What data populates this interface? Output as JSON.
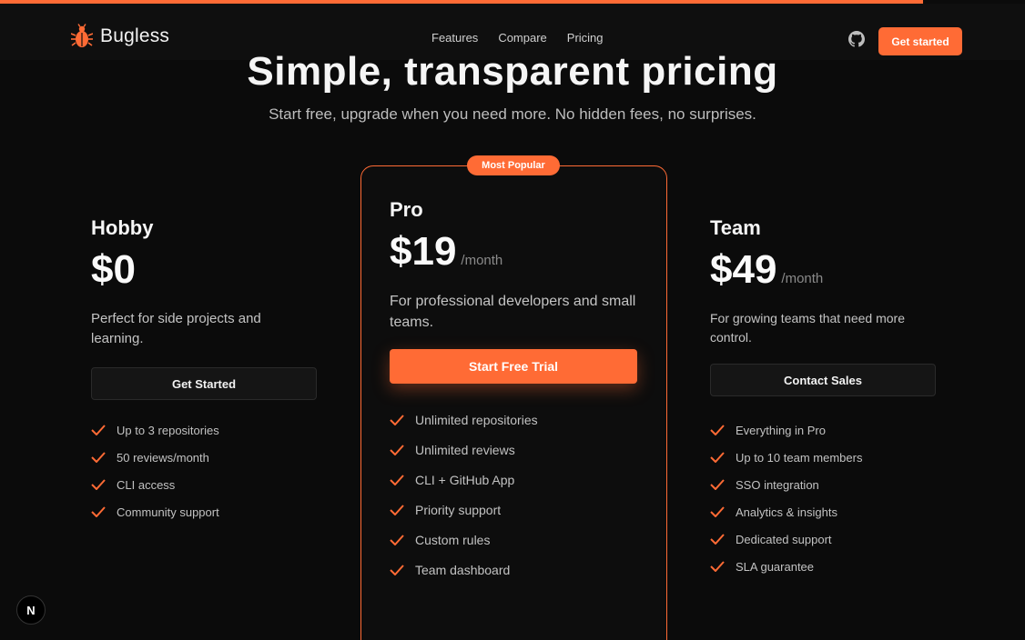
{
  "colors": {
    "accent": "#ff6b35",
    "background": "#0b0b0b"
  },
  "navbar": {
    "brand": "Bugless",
    "brand_icon": "bug-icon",
    "links": [
      "Features",
      "Compare",
      "Pricing"
    ],
    "github_icon": "github-icon",
    "cta": "Get started"
  },
  "hero": {
    "title": "Simple, transparent pricing",
    "subtitle": "Start free, upgrade when you need more. No hidden fees, no surprises."
  },
  "plans": [
    {
      "name": "Hobby",
      "price": "$0",
      "period": "",
      "description": "Perfect for side projects and learning.",
      "button": "Get Started",
      "features": [
        "Up to 3 repositories",
        "50 reviews/month",
        "CLI access",
        "Community support"
      ]
    },
    {
      "name": "Pro",
      "badge": "Most Popular",
      "price": "$19",
      "period": "/month",
      "description": "For professional developers and small teams.",
      "button": "Start Free Trial",
      "features": [
        "Unlimited repositories",
        "Unlimited reviews",
        "CLI + GitHub App",
        "Priority support",
        "Custom rules",
        "Team dashboard"
      ]
    },
    {
      "name": "Team",
      "price": "$49",
      "period": "/month",
      "description": "For growing teams that need more control.",
      "button": "Contact Sales",
      "features": [
        "Everything in Pro",
        "Up to 10 team members",
        "SSO integration",
        "Analytics & insights",
        "Dedicated support",
        "SLA guarantee"
      ]
    }
  ],
  "dev_indicator": "N"
}
